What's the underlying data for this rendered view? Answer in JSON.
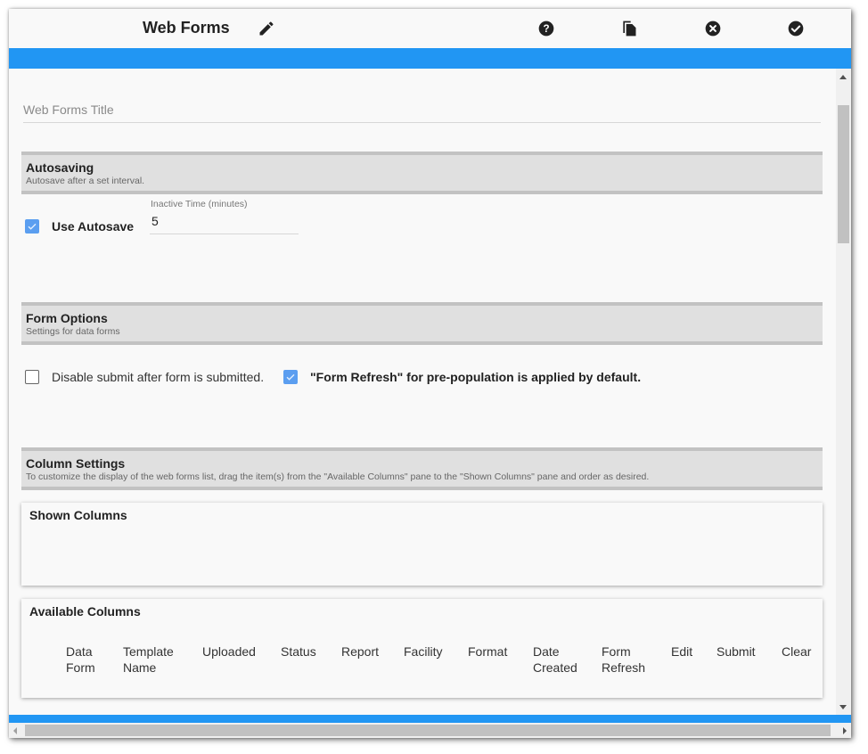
{
  "header": {
    "title": "Web Forms",
    "icons": [
      "edit-icon",
      "help-icon",
      "copy-icon",
      "cancel-icon",
      "confirm-icon"
    ]
  },
  "colors": {
    "accent": "#2196f3",
    "checkbox": "#5b9ef0",
    "section_bg": "#e0e0e0",
    "section_border": "#c2c2c2"
  },
  "title_field": {
    "placeholder": "Web Forms Title",
    "value": ""
  },
  "autosaving": {
    "heading": "Autosaving",
    "subtitle": "Autosave after a set interval.",
    "use_autosave_label": "Use Autosave",
    "use_autosave_checked": true,
    "inactive_time_label": "Inactive Time (minutes)",
    "inactive_time_value": "5"
  },
  "form_options": {
    "heading": "Form Options",
    "subtitle": "Settings for data forms",
    "disable_submit_label": "Disable submit after form is submitted.",
    "disable_submit_checked": false,
    "form_refresh_label": "\"Form Refresh\" for pre-population is applied by default.",
    "form_refresh_checked": true
  },
  "column_settings": {
    "heading": "Column Settings",
    "subtitle": "To customize the display of the web forms list, drag the item(s) from the \"Available Columns\" pane to the \"Shown Columns\" pane and order as desired.",
    "shown_columns_title": "Shown Columns",
    "shown_columns": [],
    "available_columns_title": "Available Columns",
    "available_columns": [
      {
        "line1": "Data",
        "line2": "Form"
      },
      {
        "line1": "Template",
        "line2": "Name"
      },
      {
        "line1": "Uploaded",
        "line2": ""
      },
      {
        "line1": "Status",
        "line2": ""
      },
      {
        "line1": "Report",
        "line2": ""
      },
      {
        "line1": "Facility",
        "line2": ""
      },
      {
        "line1": "Format",
        "line2": ""
      },
      {
        "line1": "Date",
        "line2": "Created"
      },
      {
        "line1": "Form",
        "line2": "Refresh"
      },
      {
        "line1": "Edit",
        "line2": ""
      },
      {
        "line1": "Submit",
        "line2": ""
      },
      {
        "line1": "Clear",
        "line2": ""
      }
    ]
  }
}
